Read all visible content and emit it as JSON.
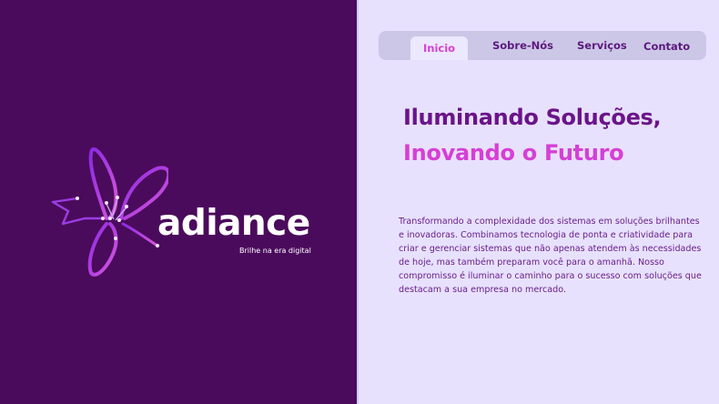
{
  "brand": {
    "name": "adiance",
    "tagline": "Brilhe na era digital",
    "colors": {
      "primary": "#4b0b5c",
      "accent": "#d63fd6",
      "dark_text": "#6a1489",
      "light_bg": "#e7e1fe"
    }
  },
  "nav": {
    "items": [
      {
        "label": "Inicio",
        "active": true
      },
      {
        "label": "Sobre-Nós",
        "active": false
      },
      {
        "label": "Serviços",
        "active": false
      },
      {
        "label": "Contato",
        "active": false
      }
    ]
  },
  "hero": {
    "headline_line1": "Iluminando Soluções,",
    "headline_line2": "Inovando o Futuro",
    "description": "Transformando a complexidade dos sistemas em soluções brilhantes e inovadoras. Combinamos tecnologia de ponta e criatividade para criar e gerenciar sistemas que não apenas atendem às necessidades de hoje, mas também preparam você para o amanhã. Nosso compromisso é iluminar o caminho para o sucesso com soluções que destacam a sua empresa no mercado."
  },
  "icons": {
    "logo": "butterfly-logo-icon"
  }
}
